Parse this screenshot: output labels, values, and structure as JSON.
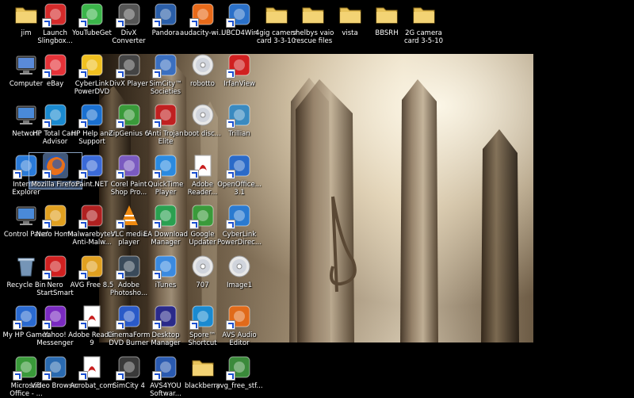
{
  "desktop": {
    "icons": [
      {
        "label": "jim",
        "icon": "folder-icon",
        "color": "#e8c35a"
      },
      {
        "label": "Launch Slingbox...",
        "icon": "slingbox-icon",
        "color": "#d42a2a"
      },
      {
        "label": "YouTubeGet",
        "icon": "download-arrow-icon",
        "color": "#3bb54a"
      },
      {
        "label": "DivX Converter",
        "icon": "divx-icon",
        "color": "#555555"
      },
      {
        "label": "Pandora",
        "icon": "pandora-icon",
        "color": "#2a5ea8"
      },
      {
        "label": "audacity-wi...",
        "icon": "audacity-icon",
        "color": "#e86a1a"
      },
      {
        "label": "UBCD4Win",
        "icon": "ubcd-icon",
        "color": "#2a70c8"
      },
      {
        "label": "4gig camera card 3-3-10",
        "icon": "folder-icon",
        "color": "#e8c35a"
      },
      {
        "label": "shelbys vaio rescue files",
        "icon": "folder-icon",
        "color": "#e8c35a"
      },
      {
        "label": "vista",
        "icon": "folder-icon",
        "color": "#e8c35a"
      },
      {
        "label": "BBSRH",
        "icon": "folder-icon",
        "color": "#e8c35a"
      },
      {
        "label": "2G camera card 3-5-10",
        "icon": "folder-icon",
        "color": "#e8c35a"
      },
      {
        "label": "Computer",
        "icon": "computer-icon",
        "color": "#5a8ad8"
      },
      {
        "label": "eBay",
        "icon": "ebay-icon",
        "color": "#e53238"
      },
      {
        "label": "CyberLink PowerDVD",
        "icon": "powerdvd-icon",
        "color": "#f0c020"
      },
      {
        "label": "DivX Player",
        "icon": "divx-player-icon",
        "color": "#444444"
      },
      {
        "label": "SimCity™ Societies",
        "icon": "simcity-icon",
        "color": "#3a6fc0"
      },
      {
        "label": "robotto",
        "icon": "disc-icon",
        "color": "#cccccc"
      },
      {
        "label": "IrfanView",
        "icon": "irfanview-icon",
        "color": "#d02020"
      },
      {
        "label": "Network",
        "icon": "network-icon",
        "color": "#4a8ad8"
      },
      {
        "label": "HP Total Care Advisor",
        "icon": "hp-advisor-icon",
        "color": "#1a8ad0"
      },
      {
        "label": "HP Help and Support",
        "icon": "help-icon",
        "color": "#1a70d0"
      },
      {
        "label": "ZipGenius 6",
        "icon": "zip-icon",
        "color": "#3a9a3a"
      },
      {
        "label": "Anti Trojan Elite",
        "icon": "shield-icon",
        "color": "#c02020"
      },
      {
        "label": "boot disc...",
        "icon": "disc-icon",
        "color": "#cccccc"
      },
      {
        "label": "Trillian",
        "icon": "trillian-icon",
        "color": "#3a8ac0"
      },
      {
        "label": "Internet Explorer",
        "icon": "ie-icon",
        "color": "#2a7ad8"
      },
      {
        "label": "Mozilla Firefox",
        "icon": "firefox-icon",
        "color": "#e8701a",
        "selected": true
      },
      {
        "label": "Paint.NET",
        "icon": "paint-icon",
        "color": "#3a6ad8"
      },
      {
        "label": "Corel Paint Shop Pro...",
        "icon": "paintshop-icon",
        "color": "#7a5ac0"
      },
      {
        "label": "QuickTime Player",
        "icon": "quicktime-icon",
        "color": "#2a8ae0"
      },
      {
        "label": "Adobe Reader...",
        "icon": "pdf-icon",
        "color": "#c81e1e"
      },
      {
        "label": "OpenOffice... 3.1",
        "icon": "openoffice-icon",
        "color": "#2a6ac8"
      },
      {
        "label": "Control Panel",
        "icon": "control-panel-icon",
        "color": "#4a8ad8"
      },
      {
        "label": "Nero Home",
        "icon": "nero-home-icon",
        "color": "#e0a020"
      },
      {
        "label": "Malwarebytes' Anti-Malw...",
        "icon": "malwarebytes-icon",
        "color": "#b02020"
      },
      {
        "label": "VLC media player",
        "icon": "vlc-icon",
        "color": "#f08a10"
      },
      {
        "label": "EA Download Manager",
        "icon": "ea-icon",
        "color": "#2aa050"
      },
      {
        "label": "Google Updater",
        "icon": "google-updater-icon",
        "color": "#3a9a3a"
      },
      {
        "label": "CyberLink PowerDirec...",
        "icon": "powerdirector-icon",
        "color": "#2a7ad0"
      },
      {
        "label": "Recycle Bin",
        "icon": "recycle-bin-icon",
        "color": "#8ab0d8"
      },
      {
        "label": "Nero StartSmart",
        "icon": "nero-icon",
        "color": "#d02020"
      },
      {
        "label": "AVG Free 8.5",
        "icon": "avg-icon",
        "color": "#e0a020"
      },
      {
        "label": "Adobe Photosho...",
        "icon": "lightroom-icon",
        "color": "#3a4a5a"
      },
      {
        "label": "iTunes",
        "icon": "itunes-icon",
        "color": "#3a8ae0"
      },
      {
        "label": "707",
        "icon": "disc-icon",
        "color": "#cccccc"
      },
      {
        "label": "Image1",
        "icon": "disc-icon",
        "color": "#cccccc"
      },
      {
        "label": "My HP Games",
        "icon": "games-icon",
        "color": "#2a6ad0"
      },
      {
        "label": "Yahoo! Messenger",
        "icon": "yahoo-icon",
        "color": "#7a2ac0"
      },
      {
        "label": "Adobe Reader 9",
        "icon": "pdf-icon",
        "color": "#c81e1e"
      },
      {
        "label": "CinemaForm DVD Burner",
        "icon": "dvd-icon",
        "color": "#2a5ac8"
      },
      {
        "label": "Desktop Manager",
        "icon": "blackberry-icon",
        "color": "#2a2a8a"
      },
      {
        "label": "Spore™ Shortcut",
        "icon": "spore-icon",
        "color": "#1a8ad0"
      },
      {
        "label": "AVS Audio Editor",
        "icon": "avs-audio-icon",
        "color": "#e06a1a"
      },
      {
        "label": "Microsoft Office - ...",
        "icon": "office-icon",
        "color": "#3a9a3a"
      },
      {
        "label": "Video Browser",
        "icon": "video-browser-icon",
        "color": "#2a6ab0"
      },
      {
        "label": "Acrobat_com",
        "icon": "acrobat-icon",
        "color": "#c81e1e"
      },
      {
        "label": "SimCity 4",
        "icon": "simcity4-icon",
        "color": "#3a3a3a"
      },
      {
        "label": "AVS4YOU Softwar...",
        "icon": "avs4you-icon",
        "color": "#2a5ab0"
      },
      {
        "label": "blackberry",
        "icon": "folder-icon",
        "color": "#e8c35a"
      },
      {
        "label": "avg_free_stf...",
        "icon": "installer-icon",
        "color": "#3a8a3a"
      }
    ]
  }
}
